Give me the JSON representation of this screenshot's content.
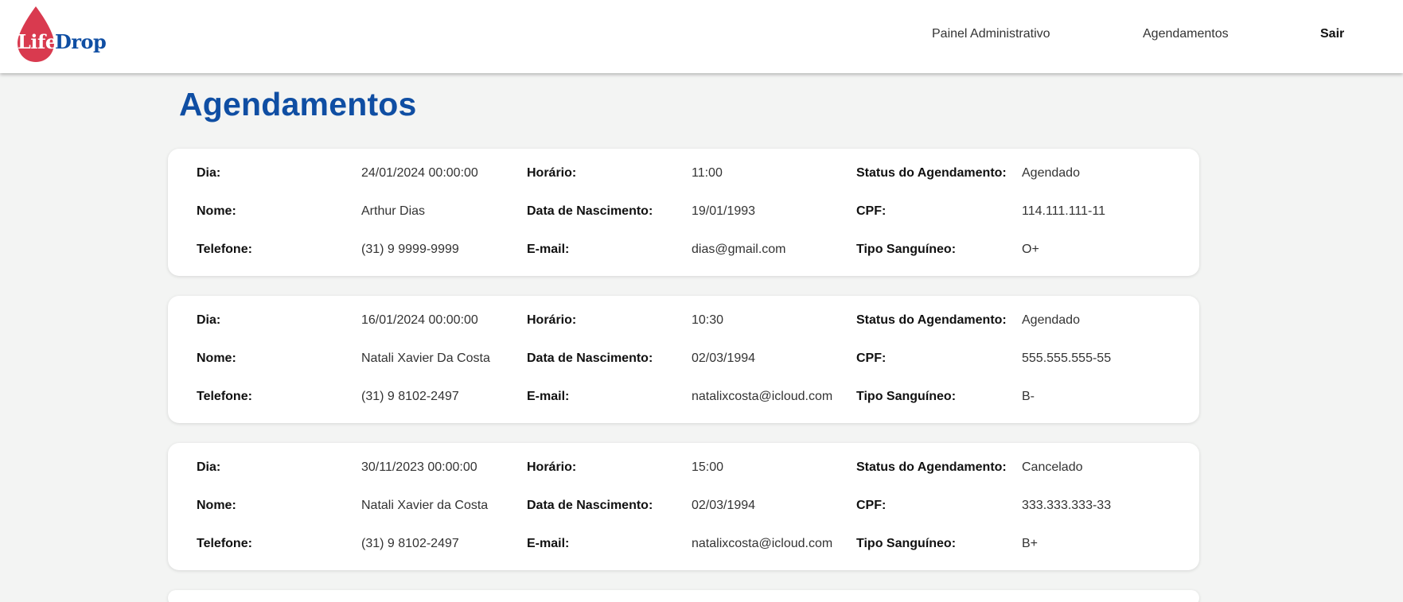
{
  "header": {
    "logo_part1": "Life",
    "logo_part2": "Drop",
    "nav": {
      "admin": "Painel Administrativo",
      "agendamentos": "Agendamentos",
      "sair": "Sair"
    }
  },
  "page": {
    "title": "Agendamentos"
  },
  "labels": {
    "dia": "Dia:",
    "horario": "Horário:",
    "status": "Status do Agendamento:",
    "nome": "Nome:",
    "nascimento": "Data de Nascimento:",
    "cpf": "CPF:",
    "telefone": "Telefone:",
    "email": "E-mail:",
    "tipo": "Tipo Sanguíneo:"
  },
  "appointments": [
    {
      "dia": "24/01/2024 00:00:00",
      "horario": "11:00",
      "status": "Agendado",
      "nome": "Arthur Dias",
      "nascimento": "19/01/1993",
      "cpf": "114.111.111-11",
      "telefone": "(31) 9 9999-9999",
      "email": "dias@gmail.com",
      "tipo": "O+"
    },
    {
      "dia": "16/01/2024 00:00:00",
      "horario": "10:30",
      "status": "Agendado",
      "nome": "Natali Xavier Da Costa",
      "nascimento": "02/03/1994",
      "cpf": "555.555.555-55",
      "telefone": "(31) 9 8102-2497",
      "email": "natalixcosta@icloud.com",
      "tipo": "B-"
    },
    {
      "dia": "30/11/2023 00:00:00",
      "horario": "15:00",
      "status": "Cancelado",
      "nome": "Natali Xavier da Costa",
      "nascimento": "02/03/1994",
      "cpf": "333.333.333-33",
      "telefone": "(31) 9 8102-2497",
      "email": "natalixcosta@icloud.com",
      "tipo": "B+"
    },
    {
      "dia": "",
      "horario": "",
      "status": "",
      "nome": "",
      "nascimento": "",
      "cpf": "",
      "telefone": "",
      "email": "",
      "tipo": ""
    }
  ],
  "colors": {
    "brand_blue": "#0f4ea3",
    "brand_red": "#d93a4f",
    "background": "#f3f4f3"
  }
}
